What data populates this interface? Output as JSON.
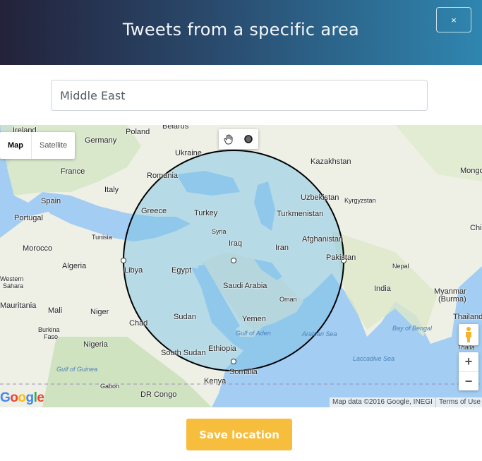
{
  "header": {
    "title": "Tweets from a specific area",
    "close_label": "×"
  },
  "search": {
    "value": "Middle East"
  },
  "map": {
    "type_buttons": [
      {
        "label": "Map",
        "active": true
      },
      {
        "label": "Satellite",
        "active": false
      }
    ],
    "tools": [
      "hand-icon",
      "circle-icon"
    ],
    "labels": {
      "ireland": "Ireland",
      "belarus": "Belarus",
      "poland": "Poland",
      "germany": "Germany",
      "ukraine": "Ukraine",
      "kazakhstan": "Kazakhstan",
      "mongolia": "Mongo",
      "france": "France",
      "romania": "Romania",
      "uzbekistan": "Uzbekistan",
      "kyrgyzstan": "Kyrgyzstan",
      "italy": "Italy",
      "spain": "Spain",
      "greece": "Greece",
      "turkey": "Turkey",
      "turkmenistan": "Turkmenistan",
      "china": "Chin",
      "portugal": "Portugal",
      "tunisia": "Tunisia",
      "syria": "Syria",
      "afghanistan": "Afghanistan",
      "morocco": "Morocco",
      "iraq": "Iraq",
      "iran": "Iran",
      "pakistan": "Pakistan",
      "algeria": "Algeria",
      "libya": "Libya",
      "egypt": "Egypt",
      "nepal": "Nepal",
      "western_sahara_1": "Western",
      "western_sahara_2": "Sahara",
      "saudi_arabia": "Saudi Arabia",
      "india": "India",
      "myanmar_1": "Myanmar",
      "myanmar_2": "(Burma)",
      "oman": "Oman",
      "mauritania": "Mauritania",
      "mali": "Mali",
      "niger": "Niger",
      "sudan": "Sudan",
      "yemen": "Yemen",
      "thailand": "Thailand",
      "chad": "Chad",
      "burkina_1": "Burkina",
      "burkina_2": "Faso",
      "gulf_of_aden": "Gulf of Aden",
      "arabian_sea": "Arabian Sea",
      "bay_of_bengal": "Bay of Bengal",
      "nigeria": "Nigeria",
      "ethiopia": "Ethiopia",
      "thailand_2": "Thaila",
      "south_sudan": "South Sudan",
      "somalia": "Somalia",
      "laccadive_sea": "Laccadive Sea",
      "gulf_of_guinea": "Gulf of Guinea",
      "gabon": "Gabon",
      "kenya": "Kenya",
      "dr_congo": "DR Congo"
    },
    "attribution": "Map data ©2016 Google, INEGI",
    "terms": "Terms of Use",
    "logo": "Google",
    "zoom_in": "+",
    "zoom_out": "−",
    "colors": {
      "water": "#a3cdf2",
      "land": "#eef0e6",
      "land_green": "#d3e6c3",
      "circle_fill": "#7ec4e6",
      "circle_stroke": "#000000"
    }
  },
  "footer": {
    "save_label": "Save location",
    "save_color": "#f7bd3d"
  }
}
